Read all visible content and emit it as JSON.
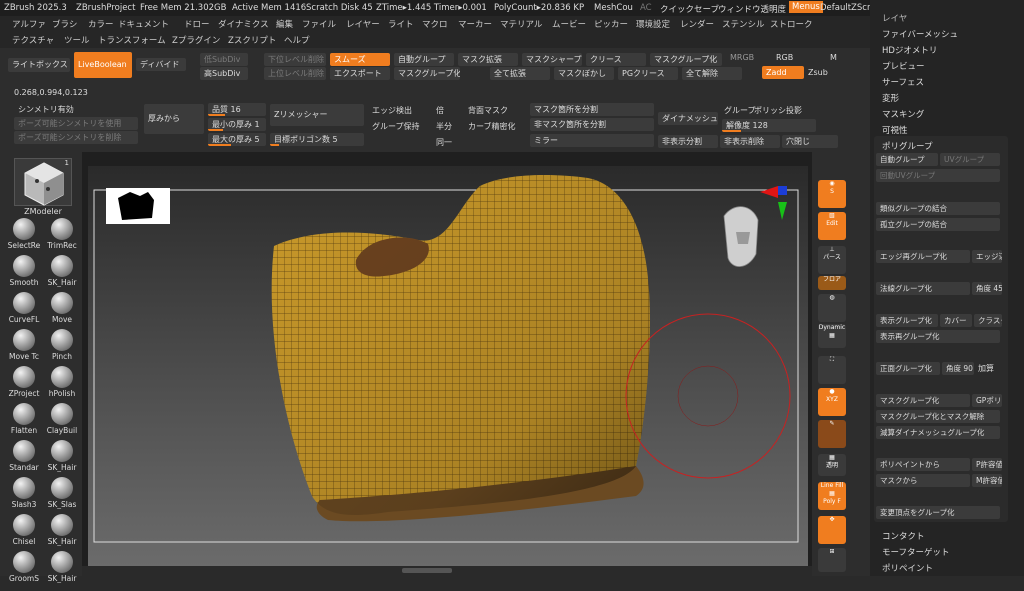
{
  "titlebar": {
    "app": "ZBrush 2025.3",
    "project": "ZBrushProject",
    "free_mem": "Free Mem 21.302GB",
    "active_mem": "Active Mem 1416",
    "scratch": "Scratch Disk 45",
    "ztime": "ZTime▸1.445 Timer▸0.001",
    "polycount": "PolyCount▸20.836 KP",
    "meshcount": "MeshCou",
    "ac": "AC",
    "quicksave": "クイックセーブ",
    "window_transp": "ウィンドウ透明度",
    "menus": "Menus",
    "script": "DefaultZScript"
  },
  "menubar": {
    "row1": [
      "アルファ",
      "ブラシ",
      "カラー",
      "ドキュメント",
      "ドロー",
      "ダイナミクス",
      "編集",
      "ファイル",
      "レイヤー",
      "ライト",
      "マクロ",
      "マーカー",
      "マテリアル",
      "ムービー",
      "ピッカー",
      "環境設定",
      "レンダー",
      "ステンシル",
      "ストローク"
    ],
    "row2": [
      "テクスチャ",
      "ツール",
      "トランスフォーム",
      "Zプラグイン",
      "Zスクリプト",
      "ヘルプ"
    ]
  },
  "toolbar": {
    "lightbox": "ライトボックス",
    "liveboolean": "LiveBoolean",
    "divide": "ディバイド",
    "low_subdiv": "低SubDiv",
    "high_subdiv": "高SubDiv",
    "del_lower": "下位レベル削除",
    "del_higher": "上位レベル削除",
    "smooth": "スムーズ",
    "export": "エクスポート",
    "auto_group": "自動グループ",
    "mask_group": "マスクグループ化",
    "mask_expand": "マスク拡張",
    "grow_all": "全て拡張",
    "mask_sharpen": "マスクシャープ",
    "mask_blur": "マスクぼかし",
    "crease": "クリース",
    "pg_crease": "PGクリース",
    "mask_group2": "マスクグループ化",
    "all_clear": "全て解除",
    "mrgb": "MRGB",
    "rgb": "RGB",
    "m": "M",
    "zadd": "Zadd",
    "zsub": "Zsub",
    "coords": "0.268,0.994,0.123",
    "symmetry": "シンメトリ有効",
    "pose_sym_use": "ポーズ可能シンメトリを使用",
    "pose_sym_del": "ポーズ可能シンメトリを削除",
    "thicken": "厚みから",
    "quality": "品質 16",
    "min_thick": "最小の厚み 1",
    "max_thick": "最大の厚み 5",
    "zremesher": "Zリメッシャー",
    "target_poly": "目標ポリゴン数 5",
    "edge_detect": "エッジ検出",
    "keep_groups": "グループ保持",
    "double": "倍",
    "half": "半分",
    "same": "同一",
    "back_mask": "背面マスク",
    "curve_refine": "カーブ精密化",
    "split_masked": "マスク箇所を分割",
    "split_unmasked": "非マスク箇所を分割",
    "mirror": "ミラー",
    "dynamesh": "ダイナメッシュ",
    "group": "グループ",
    "polish": "ポリッシ",
    "project": "投影",
    "resolution": "解像度 128",
    "hidden_split": "非表示分割",
    "hidden_delete": "非表示削除",
    "close_holes": "穴閉じ"
  },
  "brushes": [
    {
      "label": "ZModeler",
      "icon": "zmodeler-icon"
    },
    {
      "label": "SelectRe",
      "icon": "select-rect-icon"
    },
    {
      "label": "TrimRec",
      "icon": "trim-rect-icon"
    },
    {
      "label": "Smooth",
      "icon": "smooth-brush-icon"
    },
    {
      "label": "SK_Hair",
      "icon": "hair-brush-icon"
    },
    {
      "label": "CurveFL",
      "icon": "curve-brush-icon"
    },
    {
      "label": "Move",
      "icon": "move-brush-icon"
    },
    {
      "label": "Move Tc",
      "icon": "move-topo-brush-icon"
    },
    {
      "label": "Pinch",
      "icon": "pinch-brush-icon"
    },
    {
      "label": "ZProject",
      "icon": "zproject-brush-icon"
    },
    {
      "label": "hPolish",
      "icon": "hpolish-brush-icon"
    },
    {
      "label": "Flatten",
      "icon": "flatten-brush-icon"
    },
    {
      "label": "ClayBuil",
      "icon": "claybuildup-brush-icon"
    },
    {
      "label": "Standar",
      "icon": "standard-brush-icon"
    },
    {
      "label": "SK_Hair",
      "icon": "hair-brush-icon"
    },
    {
      "label": "Slash3",
      "icon": "slash-brush-icon"
    },
    {
      "label": "SK_Slas",
      "icon": "slash-brush-icon"
    },
    {
      "label": "Chisel",
      "icon": "chisel-brush-icon"
    },
    {
      "label": "SK_Hair",
      "icon": "hair-brush-icon"
    },
    {
      "label": "GroomS",
      "icon": "groom-brush-icon"
    },
    {
      "label": "SK_Hair",
      "icon": "hair-brush-icon"
    }
  ],
  "shelf": {
    "dynamic": "Dynamic",
    "perspective": "パース",
    "floor": "フロア",
    "transp": "透明",
    "polyf": "Poly F",
    "live_pol": "Line Fill"
  },
  "rightpanel": {
    "layer": "レイヤ",
    "fibermesh": "ファイバーメッシュ",
    "hd_geometry": "HDジオメトリ",
    "preview": "プレビュー",
    "surface": "サーフェス",
    "deform": "変形",
    "masking": "マスキング",
    "visibility": "可視性",
    "polygroups": "ポリグループ",
    "auto_groups": "自動グループ",
    "uv_groups": "UVグループ",
    "auto_uv_groups": "回動UVグループ",
    "merge_similar": "類似グループの結合",
    "merge_isolated": "孤立グループの結合",
    "edge_regroup": "エッジ再グループ化",
    "edge_short": "エッジ辺",
    "normal_group": "法線グループ化",
    "angle45": "角度 45",
    "visible_group": "表示グループ化",
    "coverage": "カバー",
    "cluster": "クラスタ",
    "visible_regroup": "表示再グループ化",
    "front_group": "正面グループ化",
    "angle90": "角度 90",
    "add": "加算",
    "mask_group": "マスクグループ化",
    "gp_poly": "GPポリ",
    "mask_group_clear": "マスクグループ化とマスク解除",
    "reduce_dyn": "減算ダイナメッシュグループ化",
    "from_polypaint": "ポリペイントから",
    "p_tol": "P許容値",
    "from_mask": "マスクから",
    "m_tol": "M許容値",
    "change_vertex": "変更頂点をグループ化",
    "contact": "コンタクト",
    "morph_target": "モーフターゲット",
    "polypaint": "ポリペイント"
  },
  "colors": {
    "accent": "#f07d1f",
    "mesh": "#c9992a",
    "mesh_dark": "#8a6212"
  }
}
